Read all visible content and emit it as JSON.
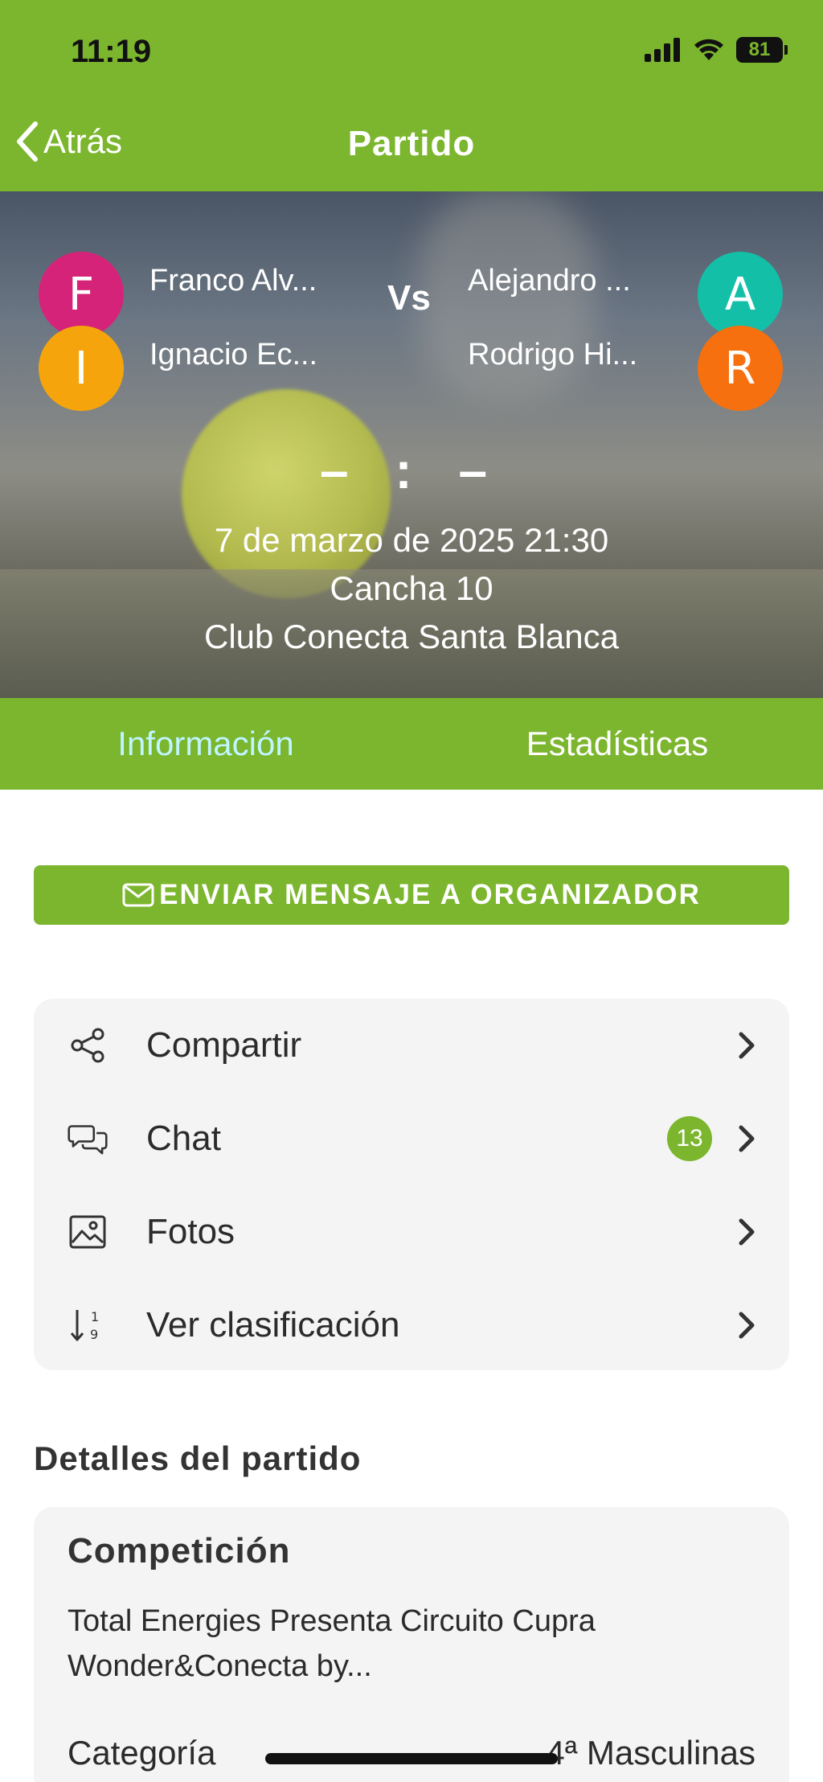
{
  "status_bar": {
    "time": "11:19",
    "battery": "81"
  },
  "nav": {
    "back_label": "Atrás",
    "title": "Partido"
  },
  "match": {
    "team1": [
      {
        "initial": "F",
        "name": "Franco Alv...",
        "color": "#d6237a"
      },
      {
        "initial": "I",
        "name": "Ignacio Ec...",
        "color": "#f5a50b"
      }
    ],
    "team2": [
      {
        "initial": "A",
        "name": "Alejandro ...",
        "color": "#14bfa8"
      },
      {
        "initial": "R",
        "name": "Rodrigo Hi...",
        "color": "#f7700f"
      }
    ],
    "vs_label": "Vs",
    "score": "– : –",
    "datetime": "7 de marzo de 2025 21:30",
    "court": "Cancha 10",
    "club": "Club Conecta Santa Blanca"
  },
  "tabs": [
    {
      "label": "Información",
      "active": true
    },
    {
      "label": "Estadísticas",
      "active": false
    }
  ],
  "message_button": {
    "label": "ENVIAR MENSAJE A ORGANIZADOR",
    "icon": "envelope-icon"
  },
  "actions": [
    {
      "label": "Compartir",
      "icon": "share-icon"
    },
    {
      "label": "Chat",
      "icon": "chat-bubbles-icon",
      "badge": "13"
    },
    {
      "label": "Fotos",
      "icon": "image-icon"
    },
    {
      "label": "Ver clasificación",
      "icon": "sort-ranking-icon"
    }
  ],
  "details": {
    "section_title": "Detalles del partido",
    "card_title": "Competición",
    "competition": "Total Energies Presenta Circuito Cupra Wonder&Conecta by...",
    "category_label": "Categoría",
    "category_value": "4ª Masculinas"
  },
  "colors": {
    "brand_green": "#7bb62e",
    "active_tab": "#bff5ff"
  }
}
